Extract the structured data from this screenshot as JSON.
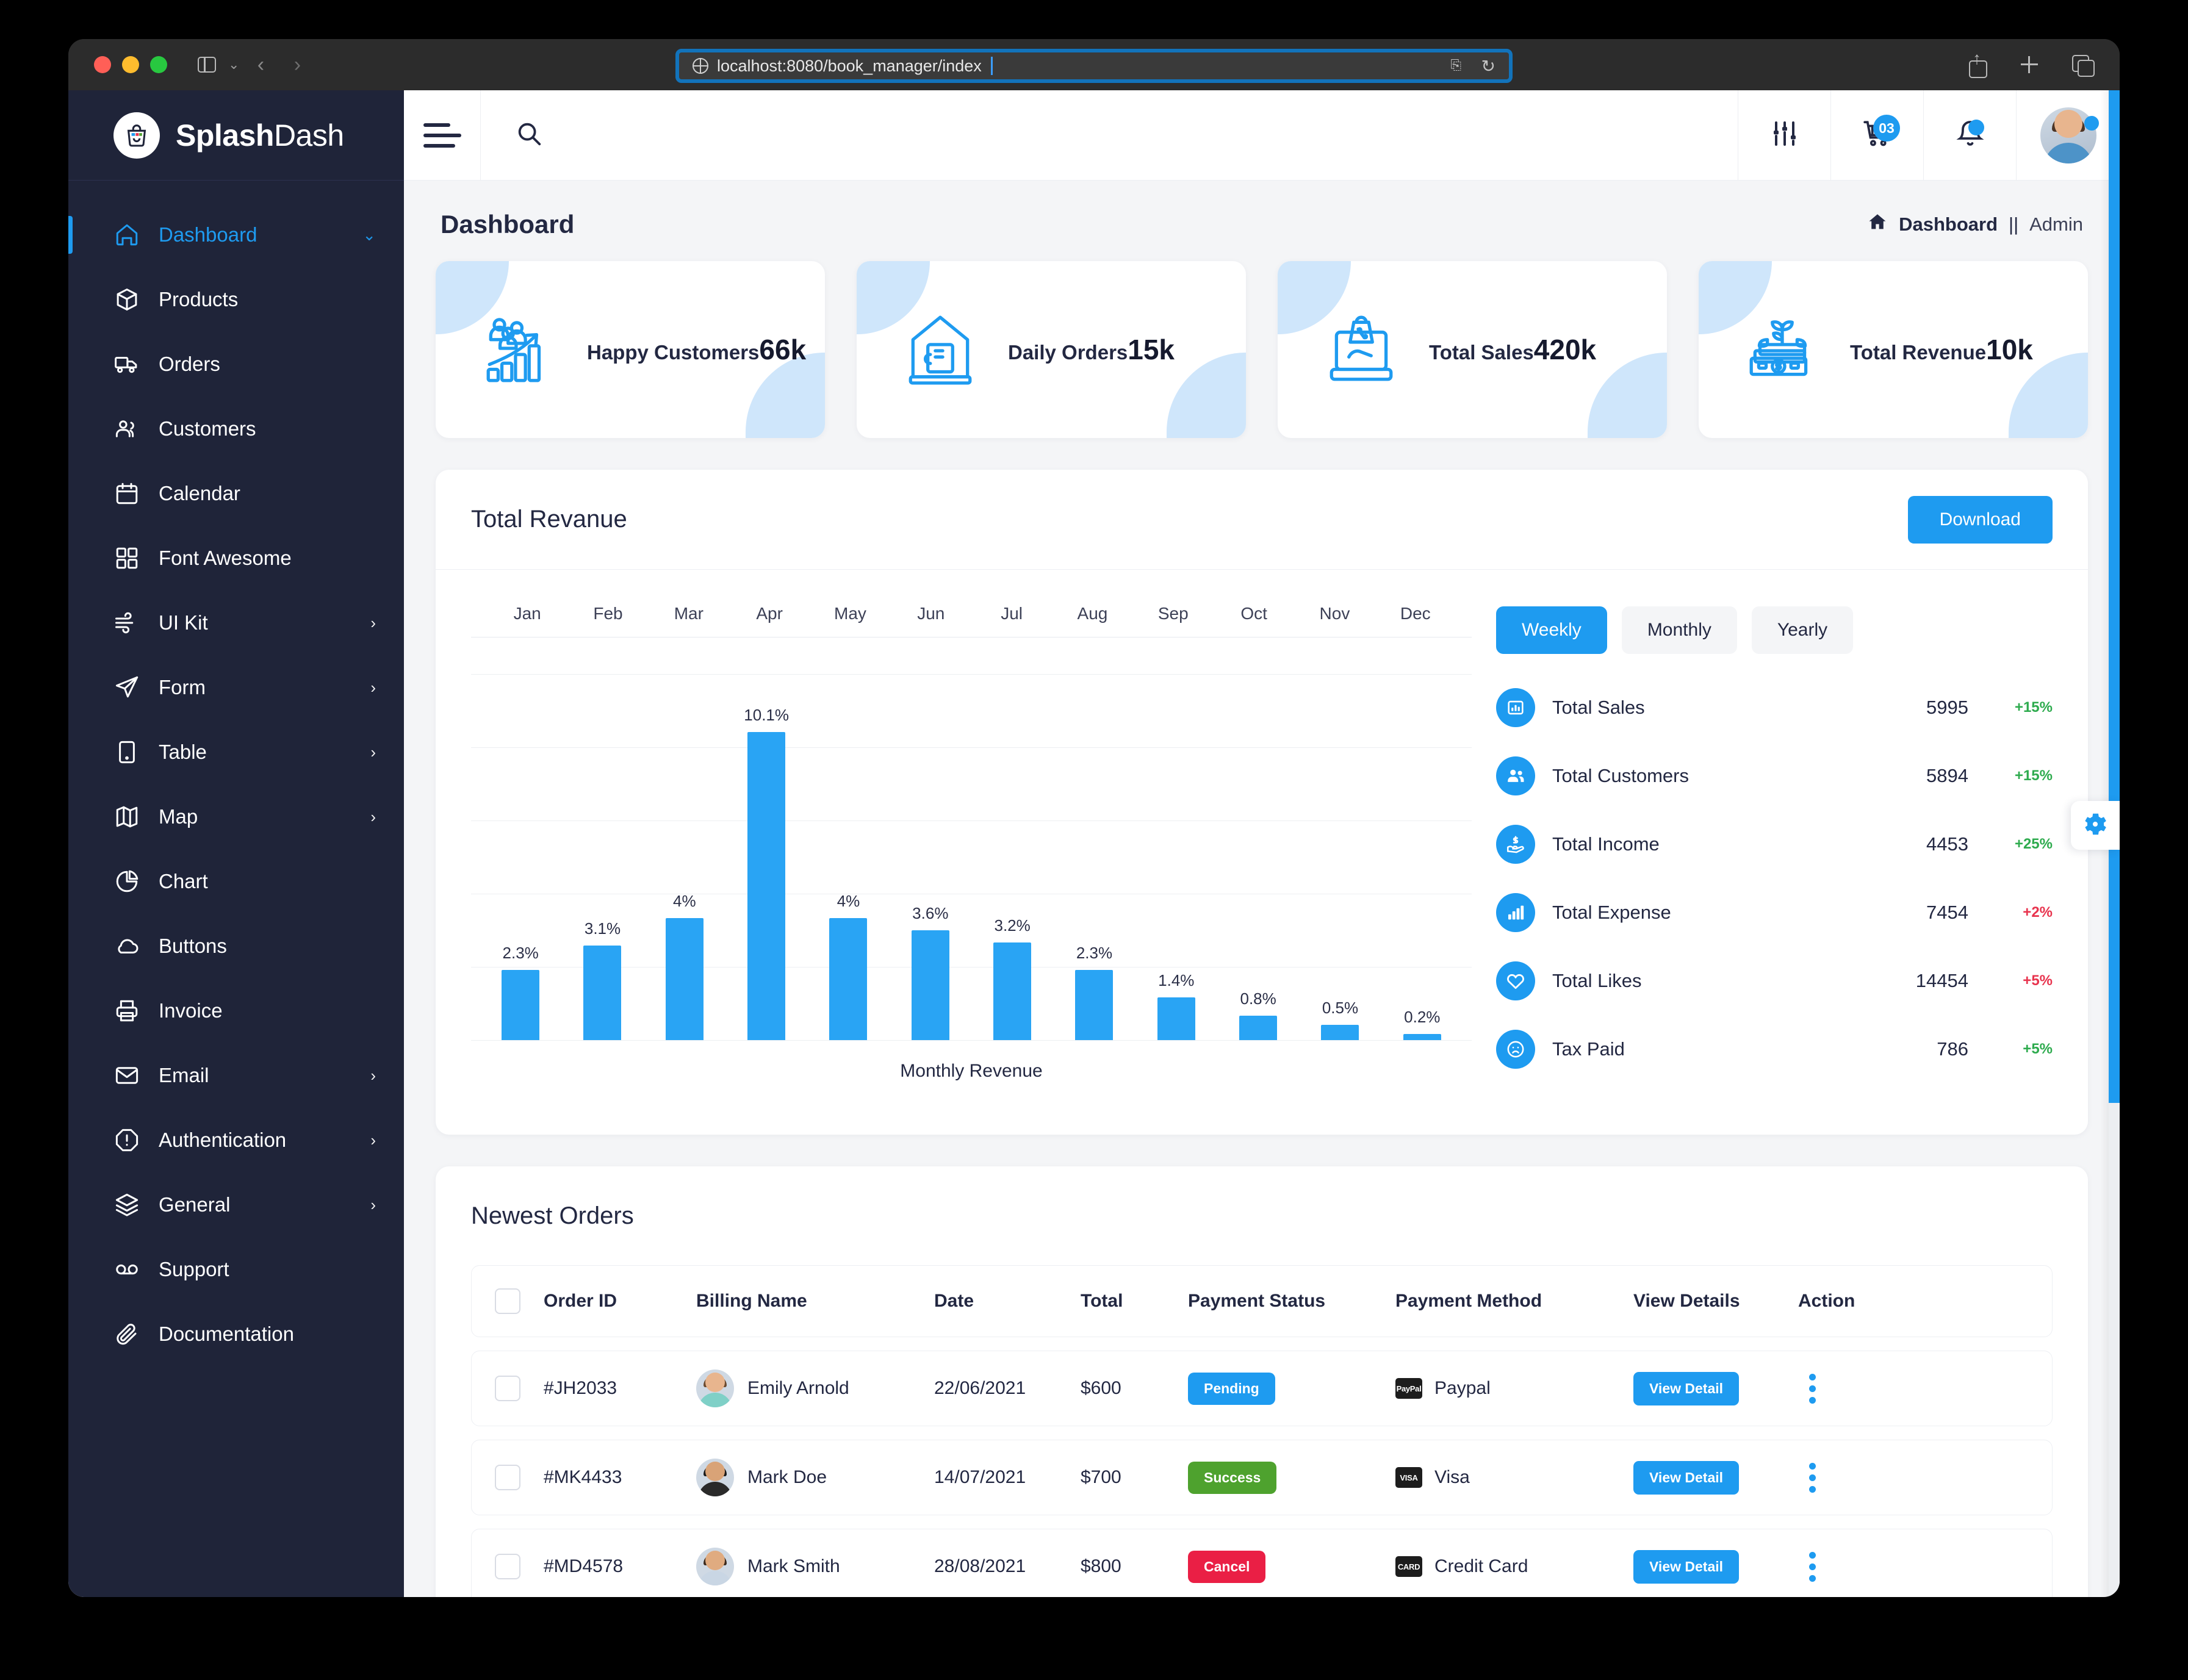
{
  "browser": {
    "url": "localhost:8080/book_manager/index",
    "back_label": "‹",
    "forward_label": "›",
    "sidebar_toggle_label": "sidebar-toggle",
    "share_label": "share",
    "new_tab_label": "new-tab",
    "tabs_label": "show-tabs",
    "reload_label": "↻",
    "translate_label": "translate"
  },
  "sidebar": {
    "brand_bold": "Splash",
    "brand_light": "Dash",
    "items": [
      {
        "label": "Dashboard",
        "icon": "home-icon",
        "active": true,
        "caret": "chevron-down"
      },
      {
        "label": "Products",
        "icon": "box-icon",
        "active": false,
        "caret": ""
      },
      {
        "label": "Orders",
        "icon": "truck-icon",
        "active": false,
        "caret": ""
      },
      {
        "label": "Customers",
        "icon": "users-icon",
        "active": false,
        "caret": ""
      },
      {
        "label": "Calendar",
        "icon": "calendar-icon",
        "active": false,
        "caret": ""
      },
      {
        "label": "Font Awesome",
        "icon": "grid-icon",
        "active": false,
        "caret": ""
      },
      {
        "label": "UI Kit",
        "icon": "wind-icon",
        "active": false,
        "caret": "chevron-right"
      },
      {
        "label": "Form",
        "icon": "send-icon",
        "active": false,
        "caret": "chevron-right"
      },
      {
        "label": "Table",
        "icon": "tablet-icon",
        "active": false,
        "caret": "chevron-right"
      },
      {
        "label": "Map",
        "icon": "map-icon",
        "active": false,
        "caret": "chevron-right"
      },
      {
        "label": "Chart",
        "icon": "pie-chart-icon",
        "active": false,
        "caret": ""
      },
      {
        "label": "Buttons",
        "icon": "cloud-icon",
        "active": false,
        "caret": ""
      },
      {
        "label": "Invoice",
        "icon": "printer-icon",
        "active": false,
        "caret": ""
      },
      {
        "label": "Email",
        "icon": "mail-icon",
        "active": false,
        "caret": "chevron-right"
      },
      {
        "label": "Authentication",
        "icon": "alert-octagon-icon",
        "active": false,
        "caret": "chevron-right"
      },
      {
        "label": "General",
        "icon": "layers-icon",
        "active": false,
        "caret": "chevron-right"
      },
      {
        "label": "Support",
        "icon": "voicemail-icon",
        "active": false,
        "caret": ""
      },
      {
        "label": "Documentation",
        "icon": "paperclip-icon",
        "active": false,
        "caret": ""
      }
    ]
  },
  "topbar": {
    "menu_icon": "hamburger-icon",
    "search_icon": "search-icon",
    "settings_icon": "sliders-icon",
    "cart_icon": "cart-icon",
    "cart_badge": "03",
    "bell_icon": "bell-icon",
    "avatar_icon": "user-avatar"
  },
  "page": {
    "title": "Dashboard",
    "breadcrumb_home": "Dashboard",
    "breadcrumb_sep": "||",
    "breadcrumb_last": "Admin"
  },
  "stats_cards": [
    {
      "label": "Happy Customers",
      "value": "66k",
      "icon": "customers-growth-icon"
    },
    {
      "label": "Daily Orders",
      "value": "15k",
      "icon": "mobile-order-icon"
    },
    {
      "label": "Total Sales",
      "value": "420k",
      "icon": "sales-tablet-icon"
    },
    {
      "label": "Total Revenue",
      "value": "10k",
      "icon": "money-plant-icon"
    }
  ],
  "revenue_panel": {
    "title": "Total Revanue",
    "download_label": "Download",
    "segments": [
      {
        "label": "Weekly",
        "active": true
      },
      {
        "label": "Monthly",
        "active": false
      },
      {
        "label": "Yearly",
        "active": false
      }
    ],
    "stats": [
      {
        "label": "Total Sales",
        "value": "5995",
        "delta": "+15%",
        "trend": "up",
        "icon": "bar-chart-icon"
      },
      {
        "label": "Total Customers",
        "value": "5894",
        "delta": "+15%",
        "trend": "up",
        "icon": "users-icon"
      },
      {
        "label": "Total Income",
        "value": "4453",
        "delta": "+25%",
        "trend": "up",
        "icon": "hand-dollar-icon"
      },
      {
        "label": "Total Expense",
        "value": "7454",
        "delta": "+2%",
        "trend": "down",
        "icon": "bars-icon"
      },
      {
        "label": "Total Likes",
        "value": "14454",
        "delta": "+5%",
        "trend": "down",
        "icon": "heart-icon"
      },
      {
        "label": "Tax Paid",
        "value": "786",
        "delta": "+5%",
        "trend": "up",
        "icon": "sad-face-icon"
      }
    ]
  },
  "chart_data": {
    "type": "bar",
    "title": "Total Revanue",
    "xlabel": "Monthly Revenue",
    "ylabel": "",
    "categories": [
      "Jan",
      "Feb",
      "Mar",
      "Apr",
      "May",
      "Jun",
      "Jul",
      "Aug",
      "Sep",
      "Oct",
      "Nov",
      "Dec"
    ],
    "values": [
      2.3,
      3.1,
      4,
      10.1,
      4,
      3.6,
      3.2,
      2.3,
      1.4,
      0.8,
      0.5,
      0.2
    ],
    "labels": [
      "2.3%",
      "3.1%",
      "4%",
      "10.1%",
      "4%",
      "3.6%",
      "3.2%",
      "2.3%",
      "1.4%",
      "0.8%",
      "0.5%",
      "0.2%"
    ],
    "ylim": [
      0,
      12
    ],
    "grid": true,
    "legend": "none",
    "bar_color": "#29a4f4"
  },
  "orders": {
    "title": "Newest Orders",
    "columns": [
      "Order ID",
      "Billing Name",
      "Date",
      "Total",
      "Payment Status",
      "Payment Method",
      "View Details",
      "Action"
    ],
    "view_detail_label": "View Detail",
    "rows": [
      {
        "order_id": "#JH2033",
        "billing_name": "Emily Arnold",
        "date": "22/06/2021",
        "total": "$600",
        "status": "Pending",
        "status_kind": "pending",
        "method": "Paypal",
        "method_badge": "PayPal",
        "avatar_hair": "#6b4a2f",
        "avatar_face": "#e8b58e",
        "avatar_body": "#7fd0c7"
      },
      {
        "order_id": "#MK4433",
        "billing_name": "Mark Doe",
        "date": "14/07/2021",
        "total": "$700",
        "status": "Success",
        "status_kind": "success",
        "method": "Visa",
        "method_badge": "VISA",
        "avatar_hair": "#1a1a1a",
        "avatar_face": "#d9a377",
        "avatar_body": "#2a2a2a"
      },
      {
        "order_id": "#MD4578",
        "billing_name": "Mark Smith",
        "date": "28/08/2021",
        "total": "$800",
        "status": "Cancel",
        "status_kind": "cancel",
        "method": "Credit Card",
        "method_badge": "CARD",
        "avatar_hair": "#3b2a1d",
        "avatar_face": "#e0ab80",
        "avatar_body": "#c9d6e4"
      }
    ]
  },
  "floating": {
    "gear_icon": "gear-icon"
  },
  "colors": {
    "accent": "#1e9bf0",
    "sidebar_bg": "#1f2439",
    "page_bg": "#f4f5f7",
    "success": "#4ea22e",
    "danger": "#ea1f45",
    "up": "#2eab4e",
    "down": "#e8344e"
  }
}
